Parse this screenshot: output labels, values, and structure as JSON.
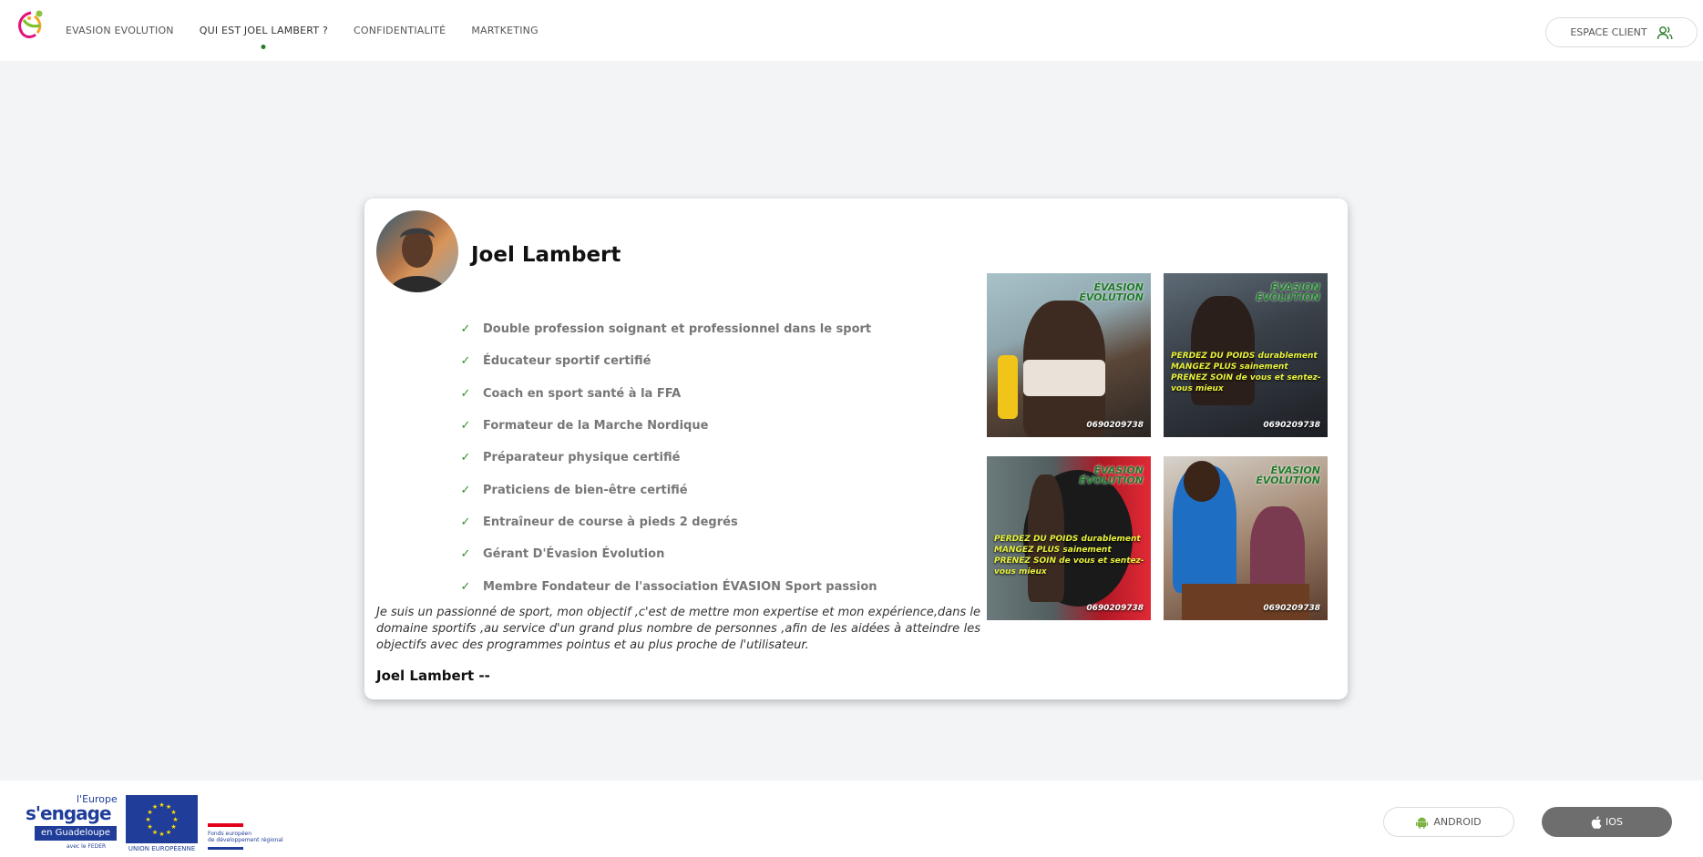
{
  "header": {
    "nav": [
      {
        "label": "EVASION EVOLUTION",
        "active": false
      },
      {
        "label": "QUI EST JOEL LAMBERT ?",
        "active": true
      },
      {
        "label": "CONFIDENTIALITÉ",
        "active": false
      },
      {
        "label": "MARTKETING",
        "active": false
      }
    ],
    "espace_client": "ESPACE CLIENT",
    "accent_color": "#2a7a2a"
  },
  "profile": {
    "name": "Joel Lambert",
    "qualifications": [
      "Double profession soignant et professionnel dans le sport",
      "Éducateur sportif certifié",
      "Coach en sport santé à la FFA",
      "Formateur de la Marche Nordique",
      "Préparateur physique certifié",
      "Praticiens de bien-être certifié",
      "Entraîneur de course à pieds 2 degrés",
      "Gérant D'Évasion Évolution",
      "Membre Fondateur de l'association ÉVASION Sport passion"
    ],
    "bio": "Je suis un passionné de sport, mon objectif ,c'est de mettre mon expertise et mon expérience,dans le domaine sportifs ,au service d'un grand plus nombre de personnes ,afin de les aidées à atteindre les objectifs avec des programmes pointus et au plus proche de l'utilisateur.",
    "signature": "Joel Lambert --"
  },
  "photos": {
    "brand_line1": "ÉVASION",
    "brand_line2": "ÉVOLUTION",
    "tag_line1": "PERDEZ DU POIDS durablement",
    "tag_line2": "MANGEZ PLUS sainement",
    "tag_line3": "PRENEZ SOIN de vous et sentez-vous mieux",
    "phone": "0690209738"
  },
  "footer": {
    "europe_line1": "l'Europe",
    "europe_line2": "s'engage",
    "europe_line3": "en Guadeloupe",
    "europe_line4": "avec le FEDER",
    "eu_label": "UNION EUROPÉENNE",
    "feder_label_1": "Fonds européen",
    "feder_label_2": "de développement régional",
    "android": "ANDROID",
    "ios": "IOS"
  }
}
